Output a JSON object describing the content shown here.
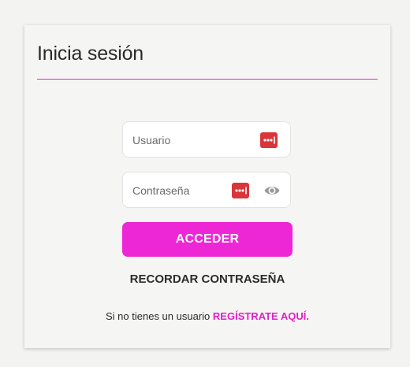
{
  "login": {
    "title": "Inicia sesión",
    "username_placeholder": "Usuario",
    "username_value": "",
    "password_placeholder": "Contraseña",
    "password_value": "",
    "submit_label": "ACCEDER",
    "recover_label": "RECORDAR CONTRASEÑA",
    "register_prompt": "Si no tienes un usuario",
    "register_link": "REGÍSTRATE AQUÍ."
  },
  "icons": {
    "username_autofill": "password-manager-icon",
    "password_autofill": "password-manager-icon",
    "password_toggle": "eye-icon"
  },
  "colors": {
    "accent": "#ed26d6",
    "link": "#e41fc9",
    "password_manager": "#d8363a"
  }
}
